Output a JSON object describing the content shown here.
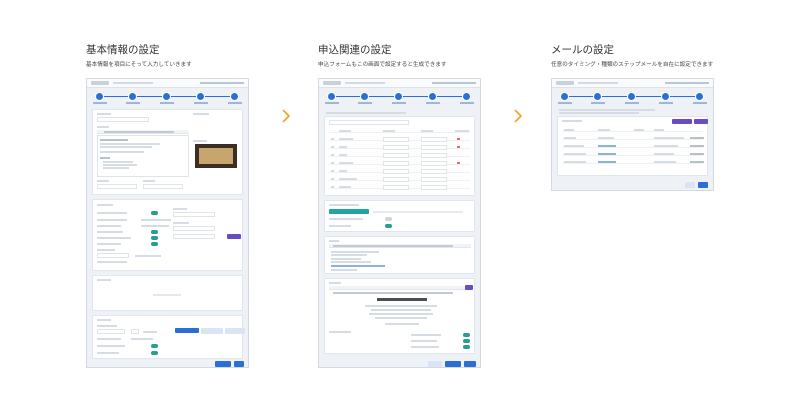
{
  "sections": [
    {
      "title": "基本情報の設定",
      "description": "基本情報を項目にそって入力していきます"
    },
    {
      "title": "申込関連の設定",
      "description": "申込フォームもこの画面で設定すると生成できます"
    },
    {
      "title": "メールの設定",
      "description": "任意のタイミング・種類のステップメールを自在に設定できます"
    }
  ],
  "icons": {
    "arrow": "chevron-right-icon"
  },
  "colors": {
    "arrow": "#f2a21b",
    "accent": "#2b6fd6",
    "panel_bg": "#eef2f6"
  }
}
